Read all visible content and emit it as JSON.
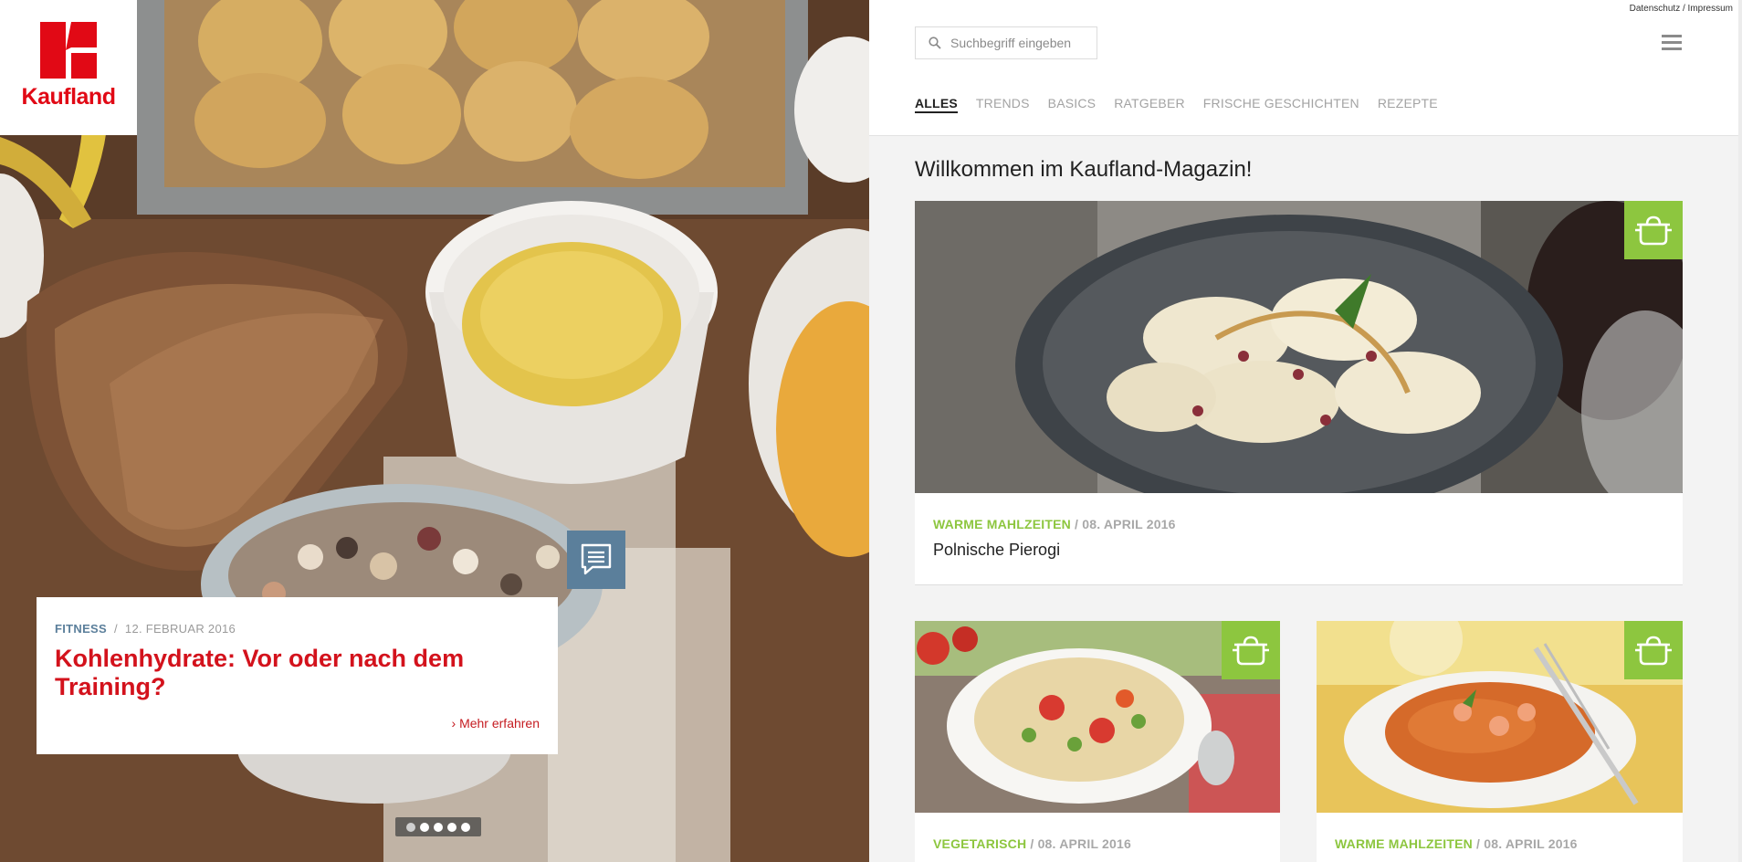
{
  "brand": {
    "name": "Kaufland",
    "color": "#e10915"
  },
  "hero": {
    "category": "FITNESS",
    "separator": "/",
    "date": "12. FEBRUAR 2016",
    "title": "Kohlenhydrate: Vor oder nach dem Training?",
    "more_link": "› Mehr erfahren",
    "slides_count": 5
  },
  "header": {
    "legal": {
      "privacy": "Datenschutz",
      "separator": " / ",
      "imprint": "Impressum"
    },
    "search": {
      "placeholder": "Suchbegriff eingeben",
      "value": ""
    },
    "nav": [
      {
        "label": "ALLES",
        "active": true
      },
      {
        "label": "TRENDS"
      },
      {
        "label": "BASICS"
      },
      {
        "label": "RATGEBER"
      },
      {
        "label": "FRISCHE GESCHICHTEN"
      },
      {
        "label": "REZEPTE"
      }
    ]
  },
  "main": {
    "welcome": "Willkommen im Kaufland-Magazin!",
    "cards": [
      {
        "category": "WARME MAHLZEITEN",
        "date": " / 08. APRIL 2016",
        "title": "Polnische Pierogi",
        "icon": "cooking-pot-icon"
      },
      {
        "category": "VEGETARISCH",
        "date": " / 08. APRIL 2016",
        "title": "",
        "icon": "cooking-pot-icon"
      },
      {
        "category": "WARME MAHLZEITEN",
        "date": " / 08. APRIL 2016",
        "title": "",
        "icon": "cooking-pot-icon"
      }
    ]
  },
  "colors": {
    "accent_green": "#8dc63f",
    "hero_red": "#d3121c",
    "fitness_blue": "#5b7f9b",
    "nav_grey": "#a3a3a3"
  }
}
